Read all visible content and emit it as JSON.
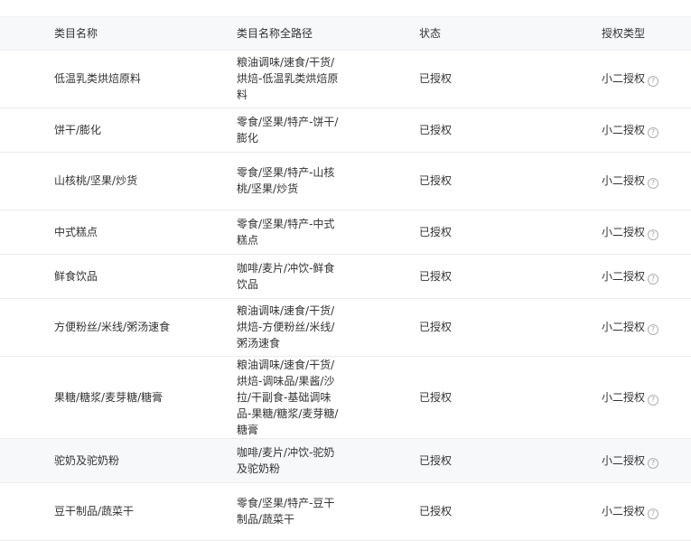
{
  "table": {
    "headers": {
      "category_name": "类目名称",
      "full_path": "类目名称全路径",
      "status": "状态",
      "auth_type": "授权类型"
    },
    "rows": [
      {
        "name": "低温乳类烘焙原料",
        "path": "粮油调味/速食/干货/烘焙-低温乳类烘焙原料",
        "status": "已授权",
        "auth": "小二授权",
        "auth_icon": "question-circle-icon"
      },
      {
        "name": "饼干/膨化",
        "path": "零食/坚果/特产-饼干/膨化",
        "status": "已授权",
        "auth": "小二授权",
        "auth_icon": "question-circle-icon"
      },
      {
        "name": "山核桃/坚果/炒货",
        "path": "零食/坚果/特产-山核桃/坚果/炒货",
        "status": "已授权",
        "auth": "小二授权",
        "auth_icon": "question-circle-icon"
      },
      {
        "name": "中式糕点",
        "path": "零食/坚果/特产-中式糕点",
        "status": "已授权",
        "auth": "小二授权",
        "auth_icon": "question-circle-icon"
      },
      {
        "name": "鲜食饮品",
        "path": "咖啡/麦片/冲饮-鲜食饮品",
        "status": "已授权",
        "auth": "小二授权",
        "auth_icon": "question-circle-icon"
      },
      {
        "name": "方便粉丝/米线/粥汤速食",
        "path": "粮油调味/速食/干货/烘焙-方便粉丝/米线/粥汤速食",
        "status": "已授权",
        "auth": "小二授权",
        "auth_icon": "question-circle-icon"
      },
      {
        "name": "果糖/糖浆/麦芽糖/糖膏",
        "path": "粮油调味/速食/干货/烘焙-调味品/果酱/沙拉/干副食-基础调味品-果糖/糖浆/麦芽糖/糖膏",
        "status": "已授权",
        "auth": "小二授权",
        "auth_icon": "question-circle-icon"
      },
      {
        "name": "驼奶及驼奶粉",
        "path": "咖啡/麦片/冲饮-驼奶及驼奶粉",
        "status": "已授权",
        "auth": "小二授权",
        "auth_icon": "question-circle-icon"
      },
      {
        "name": "豆干制品/蔬菜干",
        "path": "零食/坚果/特产-豆干制品/蔬菜干",
        "status": "已授权",
        "auth": "小二授权",
        "auth_icon": "question-circle-icon"
      }
    ]
  },
  "colors": {
    "header_bg": "#f7f8fa",
    "highlight_row_bg": "#f7f8fa",
    "border": "#ececec",
    "text": "#333333",
    "icon": "#a0a0a0"
  }
}
